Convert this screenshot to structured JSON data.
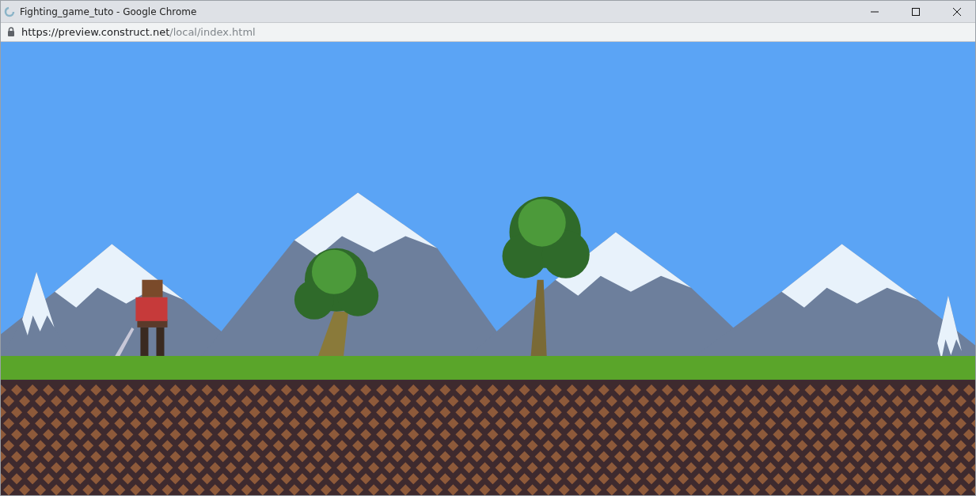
{
  "window": {
    "title": "Fighting_game_tuto - Google Chrome"
  },
  "address_bar": {
    "url_host": "https://preview.construct.net",
    "url_path": "/local/index.html"
  }
}
